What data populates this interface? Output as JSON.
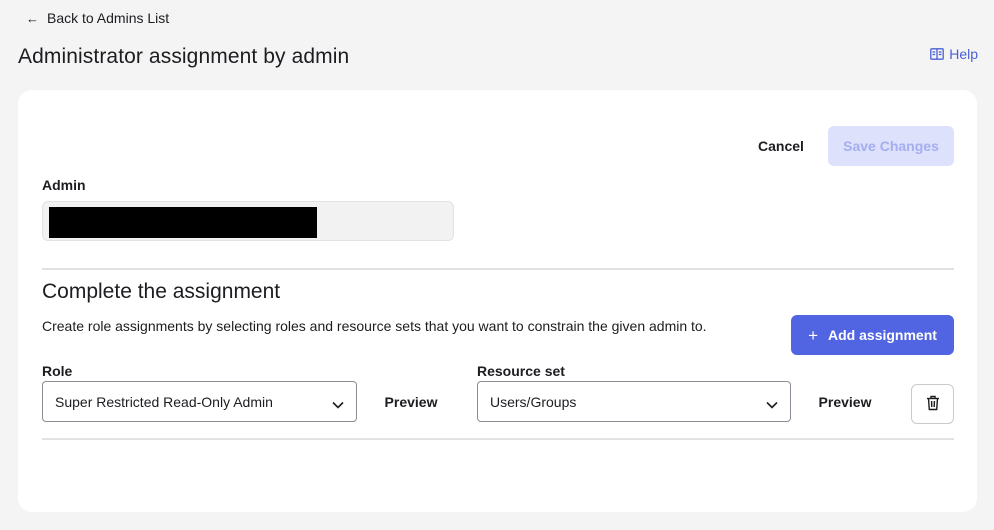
{
  "nav": {
    "back_label": "Back to Admins List",
    "back_icon": "arrow-left-icon"
  },
  "page": {
    "title": "Administrator assignment by admin"
  },
  "help": {
    "label": "Help",
    "icon": "book-icon"
  },
  "actions": {
    "cancel_label": "Cancel",
    "save_label": "Save Changes"
  },
  "admin": {
    "label": "Admin",
    "value": ""
  },
  "assignment": {
    "title": "Complete the assignment",
    "description": "Create role assignments by selecting roles and resource sets that you want to constrain the given admin to.",
    "add_label": "Add assignment",
    "row": {
      "role_label": "Role",
      "role_value": "Super Restricted Read-Only Admin",
      "role_preview": "Preview",
      "resource_label": "Resource set",
      "resource_value": "Users/Groups",
      "resource_preview": "Preview"
    }
  },
  "colors": {
    "primary": "#5165e2",
    "primary_disabled_bg": "#dde1fb",
    "primary_disabled_text": "#a5aeef",
    "link": "#4a5fd6",
    "page_bg": "#f4f4f4"
  }
}
